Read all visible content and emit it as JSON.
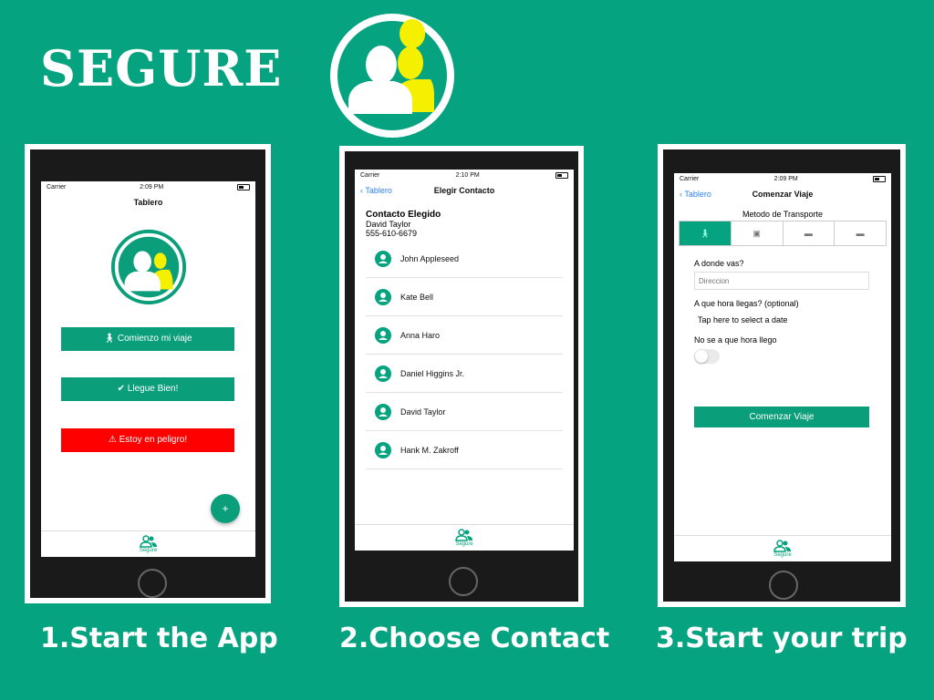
{
  "brand": {
    "name": "SEGURE"
  },
  "status": {
    "carrier": "Carrier",
    "time1": "2:09 PM",
    "time2": "2:10 PM",
    "time3": "2:09 PM"
  },
  "screen1": {
    "title": "Tablero",
    "btn_start": "Comienzo mi viaje",
    "btn_arrived": "Llegue Bien!",
    "btn_danger": "Estoy en peligro!",
    "fab": "+",
    "tab_label": "Segure",
    "colors": {
      "primary": "#0b9e7a",
      "danger": "#ff0000"
    }
  },
  "screen2": {
    "back": "Tablero",
    "title": "Elegir Contacto",
    "chosen_heading": "Contacto Elegido",
    "chosen_name": "David Taylor",
    "chosen_phone": "555-610-6679",
    "contacts": [
      "John Appleseed",
      "Kate Bell",
      "Anna Haro",
      "Daniel Higgins Jr.",
      "David Taylor",
      "Hank M. Zakroff"
    ],
    "tab_label": "Segure"
  },
  "screen3": {
    "back": "Tablero",
    "title": "Comenzar Viaje",
    "transport_label": "Metodo de Transporte",
    "transport_icons": [
      "walk-icon",
      "bus-icon",
      "car-icon",
      "taxi-icon"
    ],
    "where_label": "A donde vas?",
    "where_placeholder": "Direccion",
    "time_label": "A que hora llegas? (optional)",
    "time_hint": "Tap here to select a date",
    "unknown_label": "No se a que hora llego",
    "start_button": "Comenzar Viaje",
    "tab_label": "Segure"
  },
  "captions": {
    "step1": "1.Start the App",
    "step2": "2.Choose Contact",
    "step3": "3.Start your trip"
  }
}
